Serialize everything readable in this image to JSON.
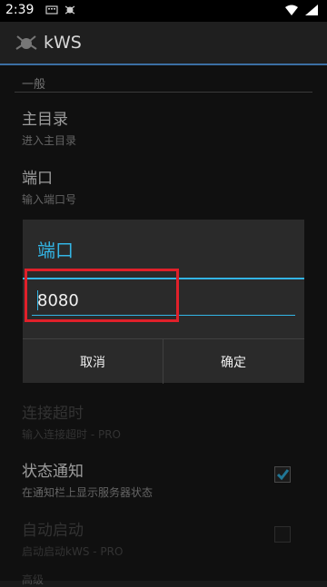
{
  "status_bar": {
    "time": "2:39"
  },
  "action_bar": {
    "title": "kWS"
  },
  "section": {
    "label": "一般"
  },
  "prefs": [
    {
      "title": "主目录",
      "summary": "进入主目录"
    },
    {
      "title": "端口",
      "summary": "输入端口号"
    },
    {
      "title": "连接超时",
      "summary": "输入连接超时 - PRO"
    },
    {
      "title": "状态通知",
      "summary": "在通知栏上显示服务器状态",
      "checked": true
    },
    {
      "title": "自动启动",
      "summary": "启动启动kWS - PRO",
      "checked": false
    },
    {
      "title": "高级"
    }
  ],
  "dialog": {
    "title": "端口",
    "input_value": "8080",
    "cancel_label": "取消",
    "ok_label": "确定"
  },
  "colors": {
    "accent": "#33b5e5",
    "highlight": "#e0202a"
  }
}
